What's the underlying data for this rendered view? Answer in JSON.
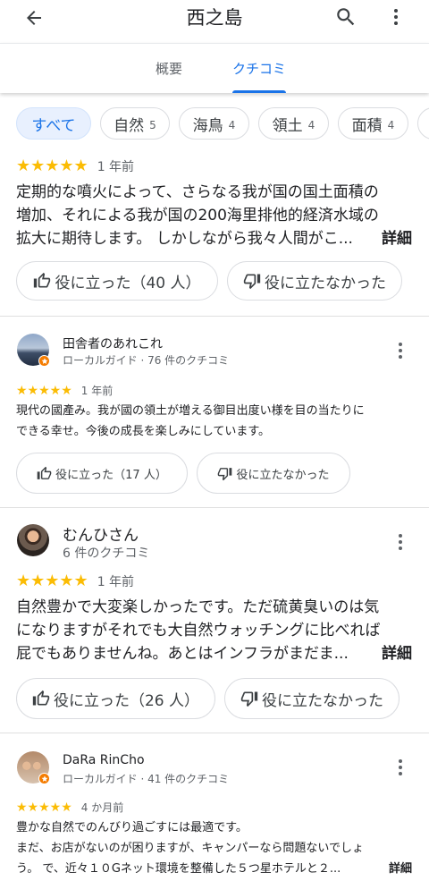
{
  "header": {
    "title": "西之島",
    "back_icon": "arrow-left-icon",
    "search_icon": "search-icon",
    "more_icon": "more-vert-icon"
  },
  "tabs": [
    {
      "label": "概要"
    },
    {
      "label": "クチコミ"
    }
  ],
  "chips": [
    {
      "label": "すべて",
      "count": ""
    },
    {
      "label": "自然",
      "count": "5"
    },
    {
      "label": "海鳥",
      "count": "4"
    },
    {
      "label": "領土",
      "count": "4"
    },
    {
      "label": "面積",
      "count": "4"
    }
  ],
  "reviews": [
    {
      "rating": 5,
      "time": "1 年前",
      "lines": [
        "定期的な噴火によって、さらなる我が国の国土面積の",
        "増加、それによる我が国の200海里排他的経済水域の",
        "拡大に期待します。 しかしながら我々人間がこ..."
      ],
      "more": "詳細",
      "helpful": "役に立った（40 人）",
      "not_helpful": "役に立たなかった"
    },
    {
      "name": "田舎者のあれこれ",
      "meta": "ローカルガイド · 76 件のクチコミ",
      "rating": 5,
      "time": "1 年前",
      "lines": [
        "現代の國產み。我が國の領土が増える御目出度い様を目の当たりに",
        "できる幸せ。今後の成長を楽しみにしています。"
      ],
      "helpful": "役に立った（17 人）",
      "not_helpful": "役に立たなかった"
    },
    {
      "name": "むんひさん",
      "meta": "6 件のクチコミ",
      "rating": 5,
      "time": "1 年前",
      "lines": [
        "自然豊かで大変楽しかったです。ただ硫黄臭いのは気",
        "になりますがそれでも大自然ウォッチングに比べれば",
        "屁でもありませんね。あとはインフラがまだま..."
      ],
      "more": "詳細",
      "helpful": "役に立った（26 人）",
      "not_helpful": "役に立たなかった"
    },
    {
      "name": "DaRa RinCho",
      "meta": "ローカルガイド · 41 件のクチコミ",
      "rating": 5,
      "time": "4 か月前",
      "lines": [
        "豊かな自然でのんびり過ごすには最適です。",
        "まだ、お店がないのが困りますが、キャンパーなら問題ないでしょ",
        "う。 で、近々１０Gネット環境を整備した５つ星ホテルと２..."
      ],
      "more": "詳細"
    }
  ],
  "colors": {
    "accent": "#1a73e8",
    "star": "#fbbc04",
    "chip_active_bg": "#e8f0fe",
    "badge": "#f57c00"
  }
}
